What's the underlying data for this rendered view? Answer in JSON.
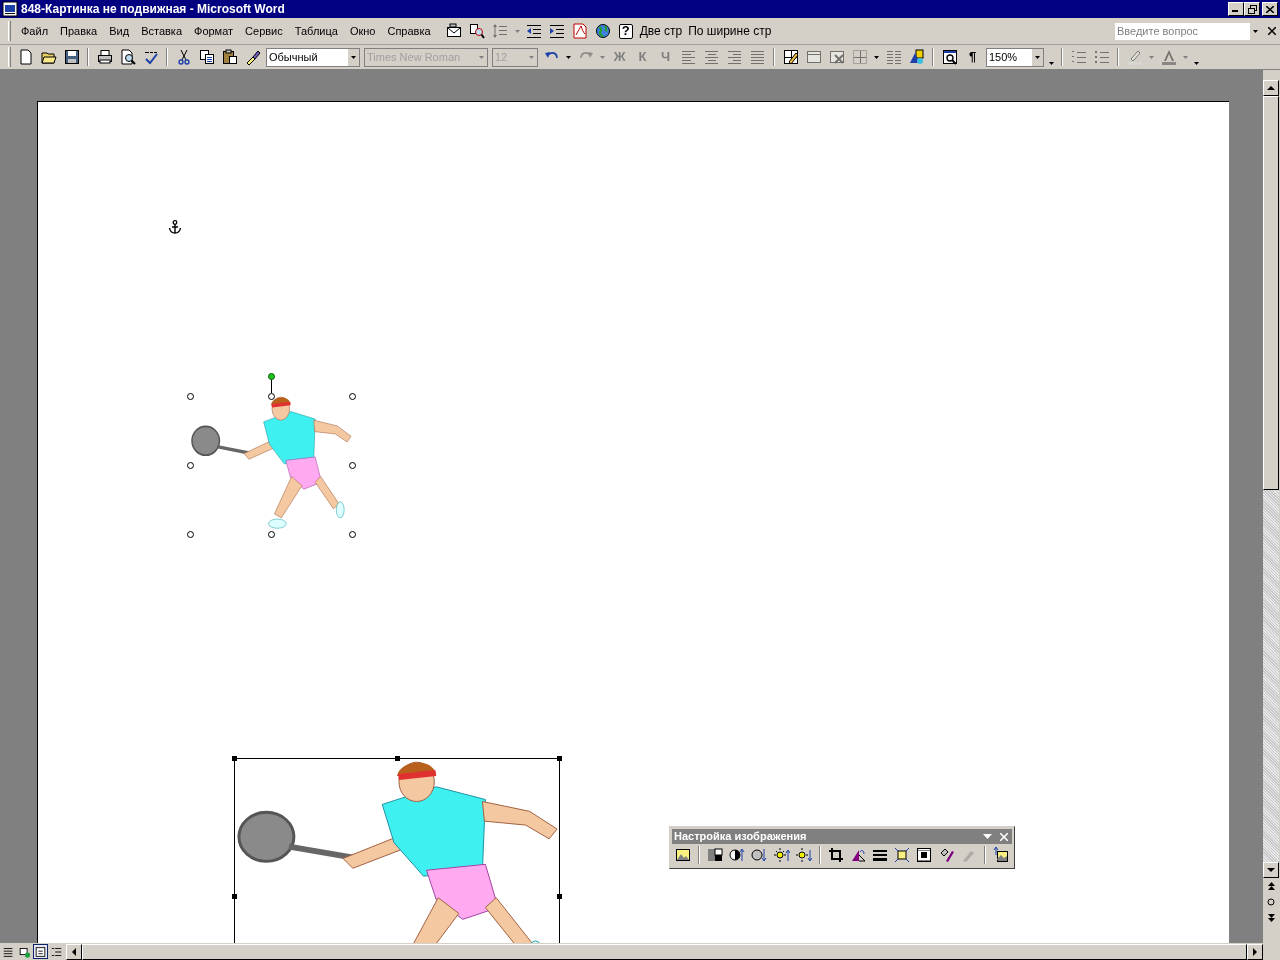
{
  "window": {
    "title": "848-Картинка не подвижная - Microsoft Word"
  },
  "menu_bar": {
    "items": [
      {
        "label": "Файл"
      },
      {
        "label": "Правка"
      },
      {
        "label": "Вид"
      },
      {
        "label": "Вставка"
      },
      {
        "label": "Формат"
      },
      {
        "label": "Сервис"
      },
      {
        "label": "Таблица"
      },
      {
        "label": "Окно"
      },
      {
        "label": "Справка"
      }
    ],
    "tools": [
      {
        "kind": "icon",
        "disabled": false
      },
      {
        "kind": "icon",
        "disabled": false
      },
      {
        "kind": "icon",
        "disabled": true
      },
      {
        "kind": "dropdown",
        "disabled": true
      },
      {
        "kind": "icon",
        "disabled": false
      },
      {
        "kind": "icon",
        "disabled": false
      },
      {
        "kind": "icon",
        "disabled": false
      },
      {
        "kind": "icon",
        "disabled": false
      },
      {
        "kind": "glyph",
        "label": "?"
      },
      {
        "kind": "text",
        "label": "Две стр"
      },
      {
        "kind": "text",
        "label": "По ширине стр"
      }
    ],
    "help_search": {
      "placeholder": "Введите вопрос"
    }
  },
  "toolbar": {
    "items": [
      {
        "kind": "icon",
        "disabled": false
      },
      {
        "kind": "icon",
        "disabled": false
      },
      {
        "kind": "icon",
        "disabled": false
      },
      {
        "kind": "separator"
      },
      {
        "kind": "icon",
        "disabled": false
      },
      {
        "kind": "icon",
        "disabled": false
      },
      {
        "kind": "icon",
        "disabled": false
      },
      {
        "kind": "separator"
      },
      {
        "kind": "icon",
        "disabled": false
      },
      {
        "kind": "icon",
        "disabled": false
      },
      {
        "kind": "icon",
        "disabled": false
      },
      {
        "kind": "icon",
        "disabled": false
      },
      {
        "kind": "combo",
        "value": "Обычный",
        "disabled": false
      },
      {
        "kind": "combo",
        "value": "Times New Roman",
        "disabled": true
      },
      {
        "kind": "combo",
        "value": "12",
        "disabled": true
      },
      {
        "kind": "icon",
        "disabled": false
      },
      {
        "kind": "dropdown",
        "disabled": false
      },
      {
        "kind": "icon",
        "disabled": true
      },
      {
        "kind": "dropdown",
        "disabled": true
      },
      {
        "kind": "glyph",
        "label": "Ж",
        "disabled": true
      },
      {
        "kind": "glyph",
        "label": "К",
        "disabled": true
      },
      {
        "kind": "glyph",
        "label": "Ч",
        "disabled": true
      },
      {
        "kind": "icon",
        "disabled": true
      },
      {
        "kind": "icon",
        "disabled": true
      },
      {
        "kind": "icon",
        "disabled": true
      },
      {
        "kind": "icon",
        "disabled": true
      },
      {
        "kind": "separator"
      },
      {
        "kind": "icon",
        "disabled": false
      },
      {
        "kind": "icon",
        "disabled": true
      },
      {
        "kind": "icon",
        "disabled": true
      },
      {
        "kind": "icon",
        "disabled": true
      },
      {
        "kind": "dropdown",
        "disabled": false
      },
      {
        "kind": "icon",
        "disabled": true
      },
      {
        "kind": "icon",
        "disabled": false
      },
      {
        "kind": "separator"
      },
      {
        "kind": "icon",
        "disabled": false
      },
      {
        "kind": "glyph",
        "label": "¶",
        "disabled": false
      },
      {
        "kind": "combo",
        "value": "150%",
        "disabled": false
      },
      {
        "kind": "chevron"
      },
      {
        "kind": "separator"
      },
      {
        "kind": "icon",
        "disabled": true
      },
      {
        "kind": "icon",
        "disabled": true
      },
      {
        "kind": "separator"
      },
      {
        "kind": "icon",
        "disabled": true
      },
      {
        "kind": "dropdown",
        "disabled": true
      },
      {
        "kind": "icon",
        "disabled": true
      },
      {
        "kind": "dropdown",
        "disabled": true
      },
      {
        "kind": "chevron"
      }
    ]
  },
  "document": {
    "pictures": [
      {
        "kind": "picture",
        "floating": true,
        "selected": true
      },
      {
        "kind": "picture",
        "floating": false,
        "selected": true
      }
    ]
  },
  "picture_toolbar": {
    "title": "Настройка изображения",
    "items": [
      {
        "kind": "icon",
        "disabled": false
      },
      {
        "kind": "separator"
      },
      {
        "kind": "icon",
        "disabled": false
      },
      {
        "kind": "icon",
        "disabled": false
      },
      {
        "kind": "icon",
        "disabled": false
      },
      {
        "kind": "icon",
        "disabled": false
      },
      {
        "kind": "icon",
        "disabled": false
      },
      {
        "kind": "separator"
      },
      {
        "kind": "icon",
        "disabled": false
      },
      {
        "kind": "icon",
        "disabled": false
      },
      {
        "kind": "icon",
        "disabled": false
      },
      {
        "kind": "icon",
        "disabled": false
      },
      {
        "kind": "icon",
        "disabled": false
      },
      {
        "kind": "icon",
        "disabled": false
      },
      {
        "kind": "icon",
        "disabled": true
      },
      {
        "kind": "separator"
      },
      {
        "kind": "icon",
        "disabled": false
      }
    ]
  },
  "view_buttons": [
    {
      "selected": false
    },
    {
      "selected": false
    },
    {
      "selected": true
    },
    {
      "selected": false
    }
  ]
}
